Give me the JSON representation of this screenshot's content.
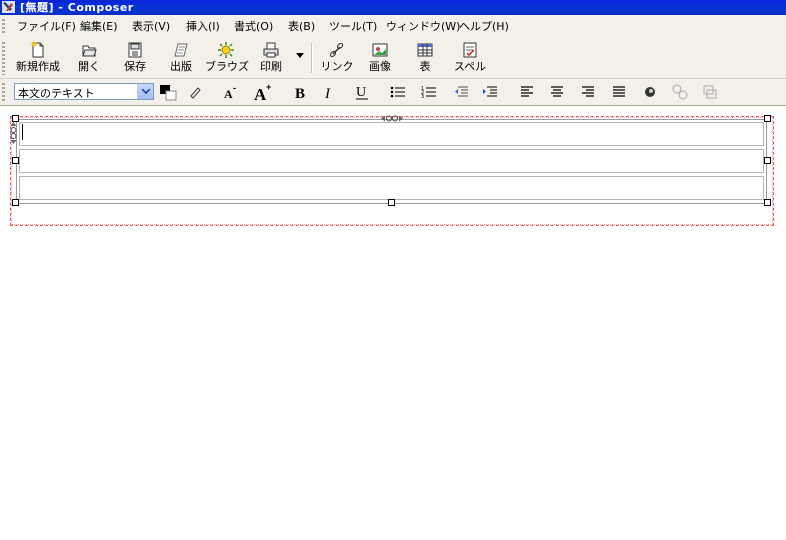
{
  "window": {
    "title": "[無題] - Composer"
  },
  "menu": [
    {
      "label": "ファイル(F)"
    },
    {
      "label": "編集(E)"
    },
    {
      "label": "表示(V)"
    },
    {
      "label": "挿入(I)"
    },
    {
      "label": "書式(O)"
    },
    {
      "label": "表(B)"
    },
    {
      "label": "ツール(T)"
    },
    {
      "label": "ウィンドウ(W)"
    },
    {
      "label": "ヘルプ(H)"
    }
  ],
  "toolbar": [
    {
      "label": "新規作成",
      "icon": "new-document-icon"
    },
    {
      "label": "開く",
      "icon": "open-folder-icon"
    },
    {
      "label": "保存",
      "icon": "save-disk-icon"
    },
    {
      "label": "出版",
      "icon": "publish-icon"
    },
    {
      "label": "ブラウズ",
      "icon": "browse-icon"
    },
    {
      "label": "印刷",
      "icon": "printer-icon"
    },
    {
      "label": "リンク",
      "icon": "link-icon"
    },
    {
      "label": "画像",
      "icon": "image-icon"
    },
    {
      "label": "表",
      "icon": "table-icon"
    },
    {
      "label": "スペル",
      "icon": "spell-check-icon"
    }
  ],
  "format": {
    "paragraph_style": "本文のテキスト",
    "text_color": "#000000",
    "background_color": "#ffffff"
  },
  "editor": {
    "table_rows": 3
  }
}
